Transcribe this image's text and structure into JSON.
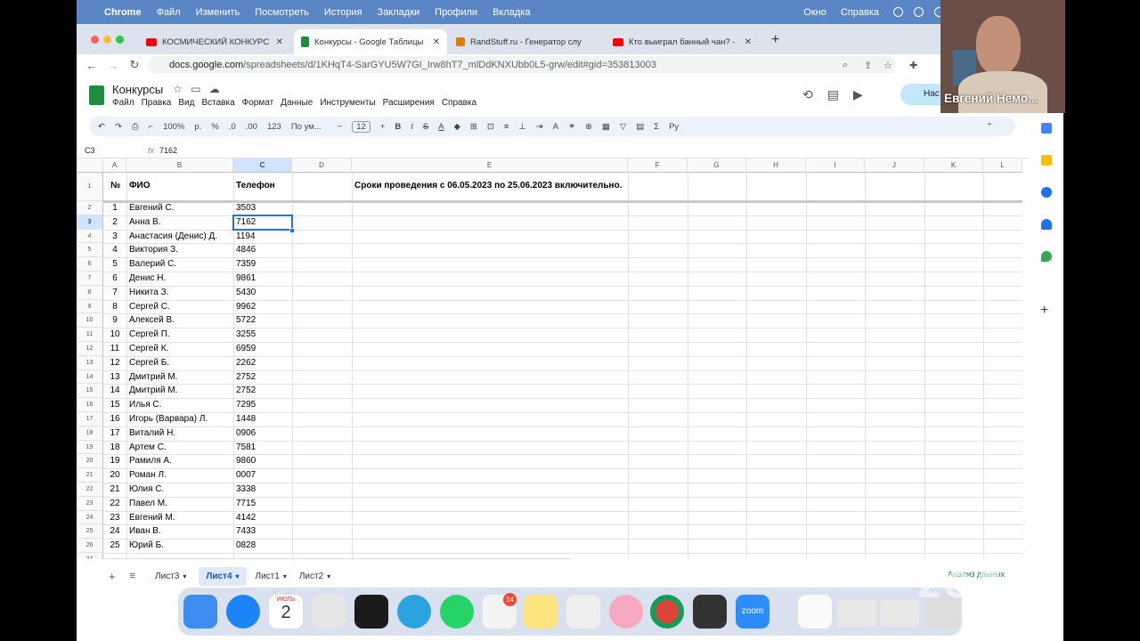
{
  "menubar": {
    "items": [
      "Chrome",
      "Файл",
      "Изменить",
      "Посмотреть",
      "История",
      "Закладки",
      "Профили",
      "Вкладка"
    ],
    "right_items": [
      "Окно",
      "Справка"
    ]
  },
  "tabs": [
    {
      "title": "КОСМИЧЕСКИЙ КОНКУРС. П",
      "icon": "youtube-icon",
      "color": "#ff0000"
    },
    {
      "title": "Конкурсы - Google Таблицы",
      "icon": "sheets-icon",
      "color": "#1e8e3e"
    },
    {
      "title": "RandStuff.ru - Генератор слу",
      "icon": "randstuff-icon",
      "color": "#e07b00"
    },
    {
      "title": "Кто выиграл банный чан? - Yo",
      "icon": "youtube-icon",
      "color": "#ff0000"
    }
  ],
  "address": {
    "host": "docs.google.com",
    "path": "/spreadsheets/d/1KHqT4-SarGYU5W7GI_Irw8hT7_mlDdKNXUbb0L5-grw/edit#gid=353813003"
  },
  "doc": {
    "title": "Конкурсы",
    "menus": [
      "Файл",
      "Правка",
      "Вид",
      "Вставка",
      "Формат",
      "Данные",
      "Инструменты",
      "Расширения",
      "Справка"
    ],
    "share_label": "Нас"
  },
  "toolbar": {
    "zoom": "100%",
    "currency": "р.",
    "percent": "%",
    "dec_less": ".0",
    "dec_more": ".00",
    "format123": "123",
    "font": "По ум...",
    "font_size": "12",
    "minus": "−",
    "plus": "+"
  },
  "formula": {
    "cell_ref": "C3",
    "fx": "fx",
    "value": "7162"
  },
  "columns": [
    "A",
    "B",
    "C",
    "D",
    "E",
    "F",
    "G",
    "H",
    "I",
    "J",
    "K",
    "L"
  ],
  "header_row": {
    "num": "№",
    "name": "ФИО",
    "phone": "Телефон",
    "note": "Сроки проведения с 06.05.2023 по 25.06.2023 включительно."
  },
  "rows": [
    {
      "n": "1",
      "name": "Евгений С.",
      "phone": "3503"
    },
    {
      "n": "2",
      "name": "Анна В.",
      "phone": "7162"
    },
    {
      "n": "3",
      "name": "Анастасия (Денис) Д.",
      "phone": "1194"
    },
    {
      "n": "4",
      "name": "Виктория З.",
      "phone": "4846"
    },
    {
      "n": "5",
      "name": "Валерий С.",
      "phone": "7359"
    },
    {
      "n": "6",
      "name": "Денис Н.",
      "phone": "9861"
    },
    {
      "n": "7",
      "name": "Никита З.",
      "phone": "5430"
    },
    {
      "n": "8",
      "name": "Сергей С.",
      "phone": "9962"
    },
    {
      "n": "9",
      "name": "Алексей В.",
      "phone": "5722"
    },
    {
      "n": "10",
      "name": "Сергей П.",
      "phone": "3255"
    },
    {
      "n": "11",
      "name": "Сергей К.",
      "phone": "6959"
    },
    {
      "n": "12",
      "name": "Сергей Б.",
      "phone": "2262"
    },
    {
      "n": "13",
      "name": "Дмитрий М.",
      "phone": "2752"
    },
    {
      "n": "14",
      "name": "Дмитрий М.",
      "phone": "2752"
    },
    {
      "n": "15",
      "name": "Илья С.",
      "phone": "7295"
    },
    {
      "n": "16",
      "name": "Игорь (Варвара) Л.",
      "phone": "1448"
    },
    {
      "n": "17",
      "name": "Виталий Н.",
      "phone": "0906"
    },
    {
      "n": "18",
      "name": "Артем С.",
      "phone": "7581"
    },
    {
      "n": "19",
      "name": "Рамиля А.",
      "phone": "9860"
    },
    {
      "n": "20",
      "name": "Роман Л.",
      "phone": "0007"
    },
    {
      "n": "21",
      "name": "Юлия С.",
      "phone": "3338"
    },
    {
      "n": "22",
      "name": "Павел М.",
      "phone": "7715"
    },
    {
      "n": "23",
      "name": "Евгений М.",
      "phone": "4142"
    },
    {
      "n": "24",
      "name": "Иван В.",
      "phone": "7433"
    },
    {
      "n": "25",
      "name": "Юрий Б.",
      "phone": "0828"
    }
  ],
  "sheets": {
    "tabs": [
      "Лист3",
      "Лист4",
      "Лист1",
      "Лист2"
    ],
    "active": "Лист4",
    "explore": "Анализ данных"
  },
  "dock": {
    "calendar_month": "ИЮЛЬ",
    "calendar_day": "2",
    "badge": "14",
    "zoom_label": "zoom"
  },
  "video": {
    "participant": "Евгений Немо..."
  },
  "watermark": "zoom"
}
